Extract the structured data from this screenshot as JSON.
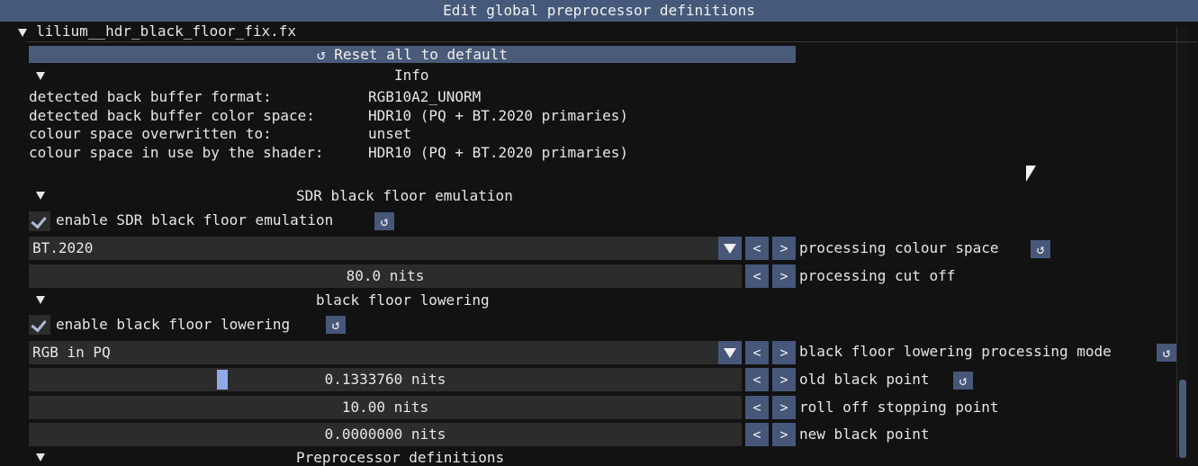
{
  "window": {
    "title": "Edit global preprocessor definitions"
  },
  "tree": {
    "shader_file": "lilium__hdr_black_floor_fix.fx"
  },
  "reset_all_label": "↺ Reset all to default",
  "info": {
    "header": "Info",
    "rows": [
      {
        "label": "detected back buffer format:",
        "value": "RGB10A2_UNORM"
      },
      {
        "label": "detected back buffer color space:",
        "value": "HDR10 (PQ + BT.2020 primaries)"
      },
      {
        "label": "colour space overwritten to:",
        "value": "unset"
      },
      {
        "label": "colour space in use by the shader:",
        "value": "HDR10 (PQ + BT.2020 primaries)"
      }
    ]
  },
  "sdr_section": {
    "header": "SDR black floor emulation",
    "enable_label": "enable SDR black floor emulation",
    "enable_checked": true,
    "processing_colour_space": {
      "value": "BT.2020",
      "label": "processing colour space"
    },
    "processing_cut_off": {
      "value": "80.0 nits",
      "label": "processing cut off"
    }
  },
  "lowering_section": {
    "header": "black floor lowering",
    "enable_label": "enable black floor lowering",
    "enable_checked": true,
    "processing_mode": {
      "value": "RGB in PQ",
      "label": "black floor lowering processing mode"
    },
    "old_black_point": {
      "value": "0.1333760 nits",
      "label": "old black point"
    },
    "roll_off_stopping_point": {
      "value": "10.00 nits",
      "label": "roll off stopping point"
    },
    "new_black_point": {
      "value": "0.0000000 nits",
      "label": "new black point"
    }
  },
  "next_header": "Preprocessor definitions",
  "glyphs": {
    "left": "<",
    "right": ">",
    "reset": "↺"
  },
  "colors": {
    "accent": "#4a5b7a",
    "title_bg": "#45597a",
    "frame_bg": "#2c2c2c",
    "slider_grab": "#8fa9e6"
  }
}
